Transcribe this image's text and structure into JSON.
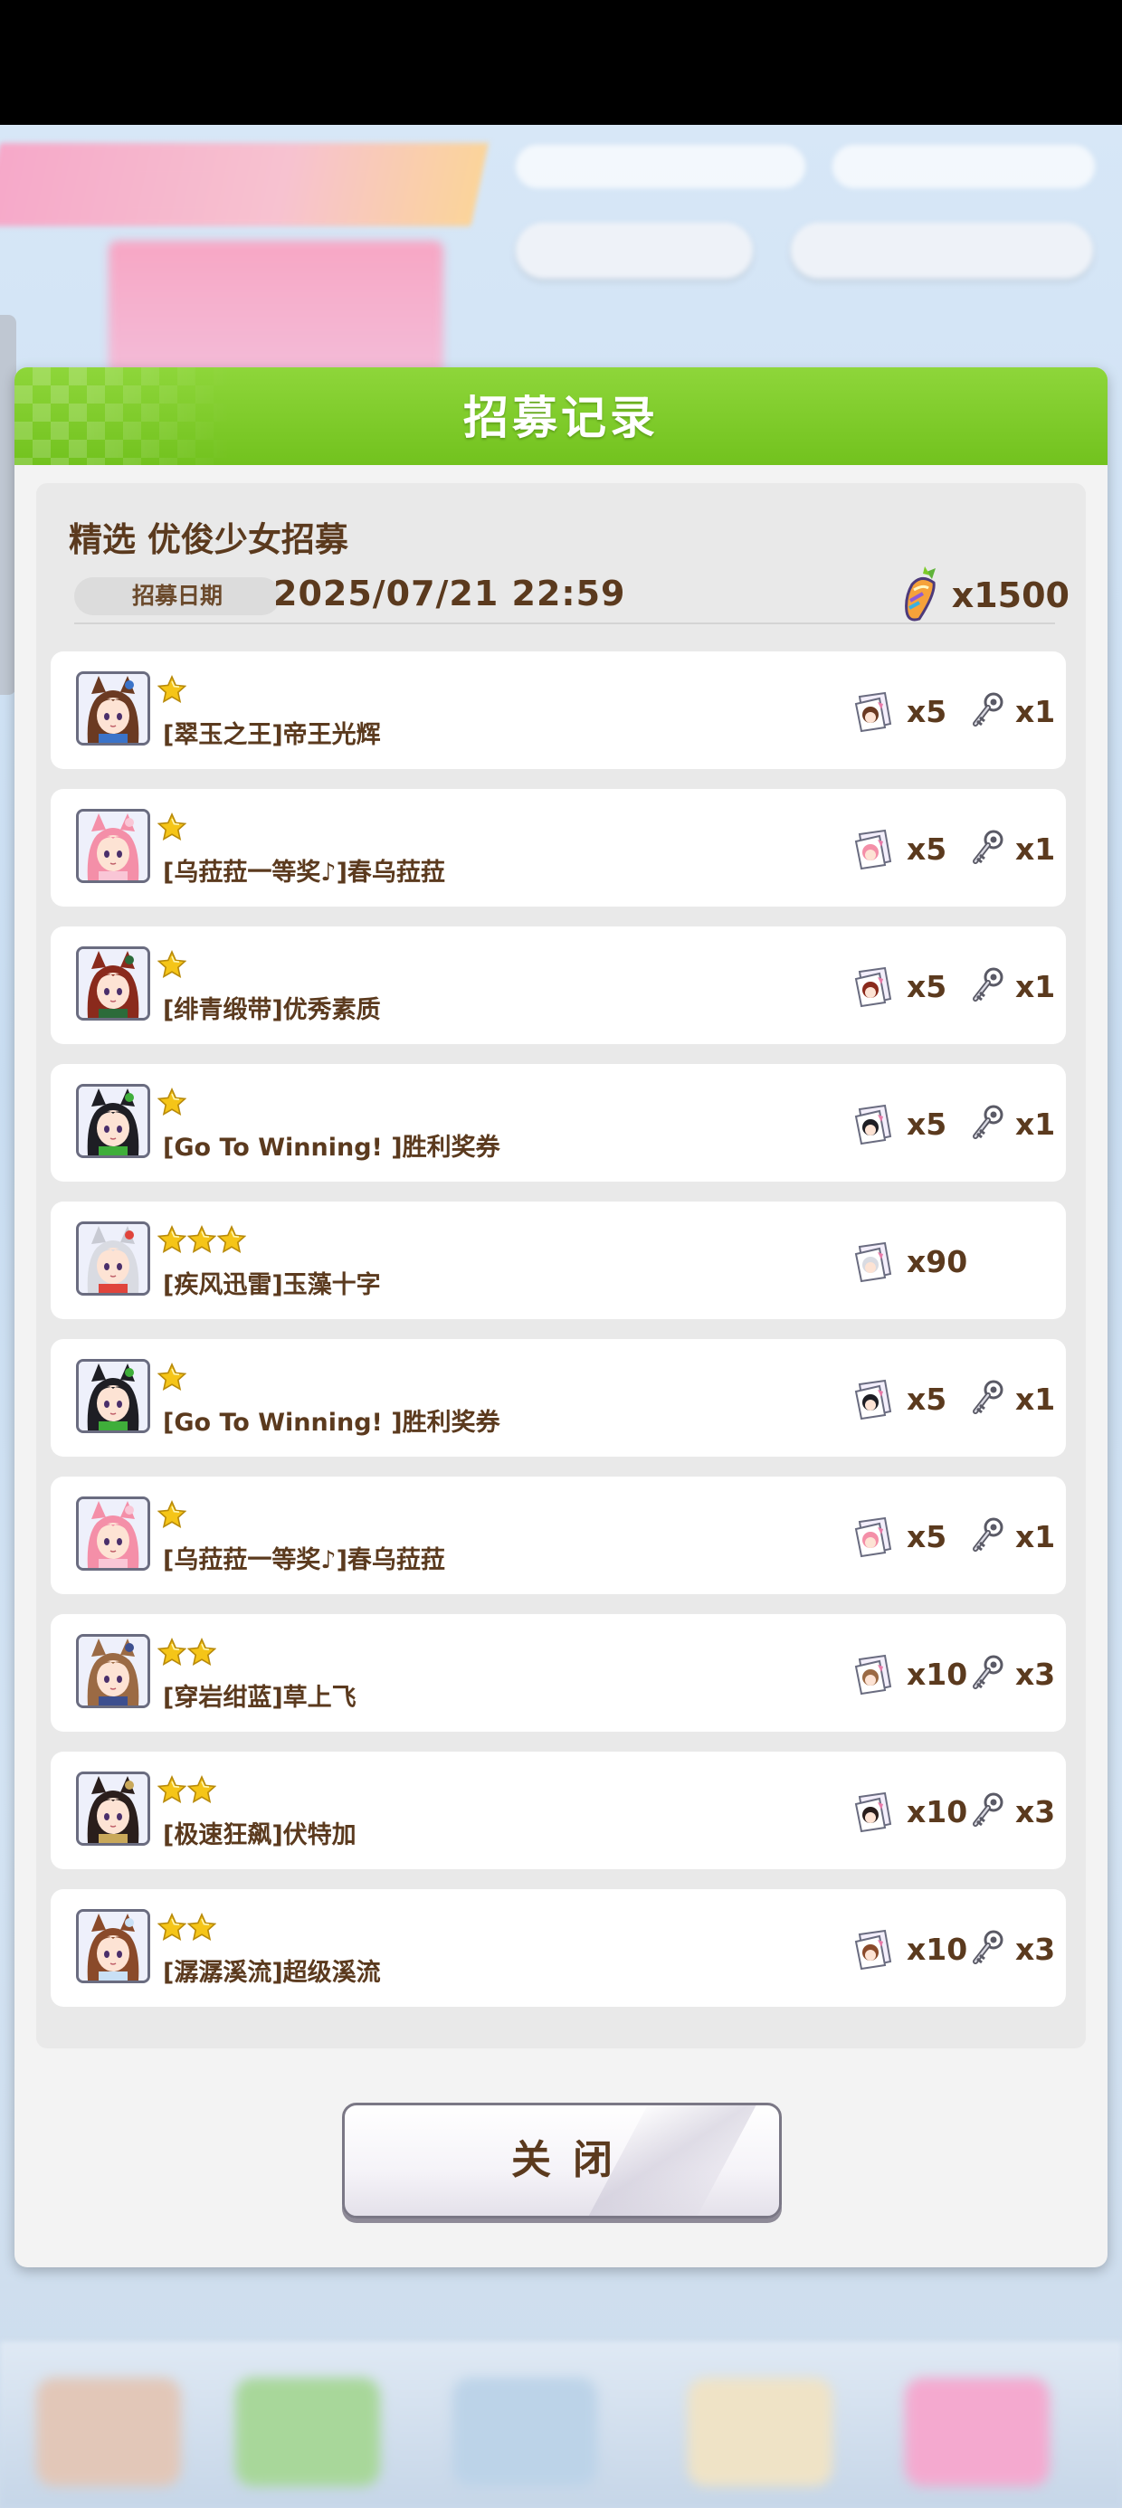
{
  "dialog": {
    "title": "招募记录",
    "banner_name": "精选  优俊少女招募",
    "date_label": "招募日期",
    "date_value": "2025/07/21  22:59",
    "cost": "x1500",
    "close_label": "关闭"
  },
  "records": [
    {
      "name": "[翠玉之王]帝王光辉",
      "stars": 1,
      "piece": "x5",
      "key": "x1",
      "hair": "#6b3a22",
      "accent": "#3a73c9",
      "ear": "#6b3a22"
    },
    {
      "name": "[乌菈菈一等奖♪]春乌菈菈",
      "stars": 1,
      "piece": "x5",
      "key": "x1",
      "hair": "#f48fa8",
      "accent": "#f9c6d6",
      "ear": "#f48fa8"
    },
    {
      "name": "[绯青缎带]优秀素质",
      "stars": 1,
      "piece": "x5",
      "key": "x1",
      "hair": "#8a2a1c",
      "accent": "#2b6b3a",
      "ear": "#8a2a1c"
    },
    {
      "name": "[Go To Winning! ]胜利奖券",
      "stars": 1,
      "piece": "x5",
      "key": "x1",
      "hair": "#1e1e24",
      "accent": "#3fae3a",
      "ear": "#1e1e24"
    },
    {
      "name": "[疾风迅雷]玉藻十字",
      "stars": 3,
      "piece": "x90",
      "key": "",
      "hair": "#d9dbe2",
      "accent": "#e0443c",
      "ear": "#c8cad3"
    },
    {
      "name": "[Go To Winning! ]胜利奖券",
      "stars": 1,
      "piece": "x5",
      "key": "x1",
      "hair": "#1e1e24",
      "accent": "#3fae3a",
      "ear": "#1e1e24"
    },
    {
      "name": "[乌菈菈一等奖♪]春乌菈菈",
      "stars": 1,
      "piece": "x5",
      "key": "x1",
      "hair": "#f48fa8",
      "accent": "#f9c6d6",
      "ear": "#f48fa8"
    },
    {
      "name": "[穿岩绀蓝]草上飞",
      "stars": 2,
      "piece": "x10",
      "key": "x3",
      "hair": "#9b6a44",
      "accent": "#3d4f8f",
      "ear": "#9b6a44"
    },
    {
      "name": "[极速狂飙]伏特加",
      "stars": 2,
      "piece": "x10",
      "key": "x3",
      "hair": "#2a1e1c",
      "accent": "#c9a85a",
      "ear": "#2a1e1c"
    },
    {
      "name": "[潺潺溪流]超级溪流",
      "stars": 2,
      "piece": "x10",
      "key": "x3",
      "hair": "#8a4a2a",
      "accent": "#c9e0f5",
      "ear": "#8a4a2a"
    }
  ],
  "icons": {
    "star": "star-icon",
    "piece": "character-piece-icon",
    "key": "key-icon",
    "currency": "carrot-currency-icon"
  },
  "colors": {
    "header_green": "#7ccb27",
    "text_brown": "#5b3a1e",
    "star_gold": "#f5c518"
  }
}
